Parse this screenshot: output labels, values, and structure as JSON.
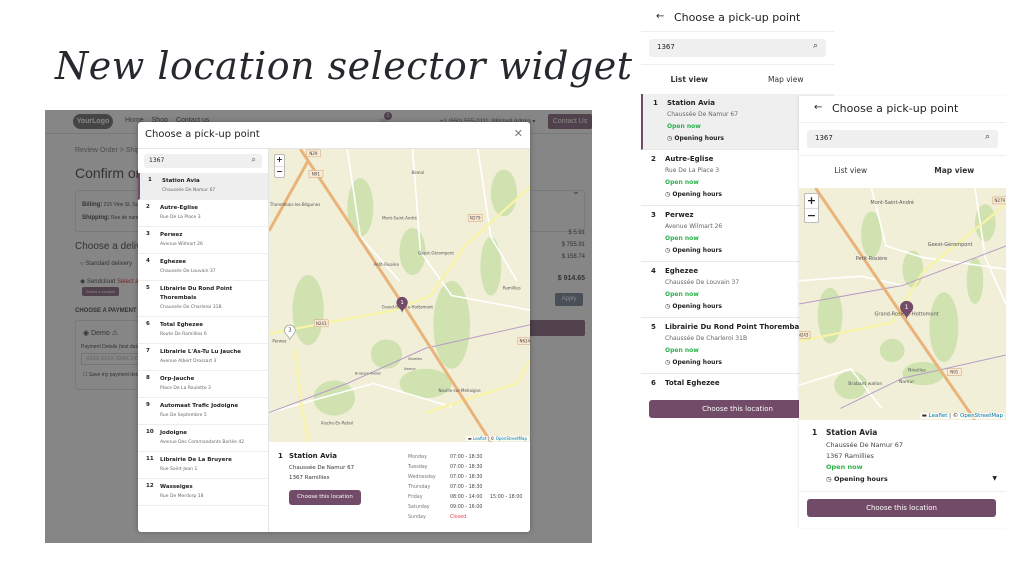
{
  "slide_title": "New location selector widget",
  "colors": {
    "brand": "#714B67",
    "open": "#2eb24a",
    "closed": "#e0454f"
  },
  "checkout": {
    "logo": "YourLogo",
    "nav": [
      "Home",
      "Shop",
      "Contact us"
    ],
    "cart_count": "1",
    "phone": "+1 (650) 555-0111",
    "user": "Mitchell Admin",
    "contact_button": "Contact Us",
    "breadcrumb": "Review Order  >  Shipping",
    "page_title": "Confirm order",
    "billing_label": "Billing:",
    "billing_value": "215 Vine St, Scranton",
    "shipping_label": "Shipping:",
    "shipping_value": "Rue de namur",
    "delivery_title": "Choose a delivery method",
    "delivery_options": [
      "Standard delivery",
      "Sendcloud"
    ],
    "sendcloud_warning": "Select a pick-up point",
    "select_location_btn": "Select a location",
    "payment_title": "CHOOSE A PAYMENT METHOD",
    "payment_option": "Demo",
    "payment_details_label": "Payment Details (test data)",
    "card_placeholder": "XXXX XXXX XXXX XXXX",
    "save_payment": "Save my payment details",
    "prices": [
      "$ 5.91",
      "$ 755.91",
      "$ 158.74"
    ],
    "total": "$ 914.65",
    "apply_button": "Apply"
  },
  "modal": {
    "title": "Choose a pick-up point",
    "search_value": "1367",
    "locations": [
      {
        "num": "1",
        "name": "Station Avia",
        "address": "Chaussée De Namur 67"
      },
      {
        "num": "2",
        "name": "Autre-Eglise",
        "address": "Rue De La Place 3"
      },
      {
        "num": "3",
        "name": "Perwez",
        "address": "Avenue Wilmart 26"
      },
      {
        "num": "4",
        "name": "Eghezee",
        "address": "Chaussée De Louvain 37"
      },
      {
        "num": "5",
        "name": "Librairie Du Rond Point Thorembais",
        "address": "Chaussée De Charleroi 31B"
      },
      {
        "num": "6",
        "name": "Total Eghezee",
        "address": "Route De Ramillies 6"
      },
      {
        "num": "7",
        "name": "Librairie L'As-Tu Lu Jauche",
        "address": "Avenue Albert Drossart 3"
      },
      {
        "num": "8",
        "name": "Orp-Jauche",
        "address": "Place De La Roulette 3"
      },
      {
        "num": "9",
        "name": "Automaat Trafic Jodoigne",
        "address": "Rue De Septembre 5"
      },
      {
        "num": "10",
        "name": "Jodoigne",
        "address": "Avenue Des Commandants Borlée 42"
      },
      {
        "num": "11",
        "name": "Librairie De La Bruyere",
        "address": "Rue Saint-Jean 1"
      },
      {
        "num": "12",
        "name": "Wasseiges",
        "address": "Rue De Merdorp 18"
      }
    ],
    "selected": {
      "num": "1",
      "name": "Station Avia",
      "street": "Chaussée De Namur 67",
      "city": "1367 Ramillies",
      "button": "Choose this location"
    },
    "hours": [
      {
        "day": "Monday",
        "t1": "07:00 - 18:30",
        "t2": ""
      },
      {
        "day": "Tuesday",
        "t1": "07:00 - 18:30",
        "t2": ""
      },
      {
        "day": "Wednesday",
        "t1": "07:00 - 18:30",
        "t2": ""
      },
      {
        "day": "Thursday",
        "t1": "07:00 - 18:30",
        "t2": ""
      },
      {
        "day": "Friday",
        "t1": "08:00 - 14:00",
        "t2": "15:00 - 18:00"
      },
      {
        "day": "Saturday",
        "t1": "09:00 - 16:00",
        "t2": ""
      },
      {
        "day": "Sunday",
        "t1": "Closed",
        "t2": ""
      }
    ],
    "map": {
      "zoom_in": "+",
      "zoom_out": "−",
      "attribution_leaflet": "Leaflet",
      "attribution_sep": " | © ",
      "attribution_osm": "OpenStreetMap",
      "places": [
        "Bomal",
        "Thorembais-les-Béguines",
        "Mont-Saint-André",
        "Geest-Gérompont",
        "Petit-Rosière",
        "Grand-Rosière-Hottomont",
        "Ramillies",
        "Perwez",
        "Noville-sur-Mehaigne",
        "Aische-En-Refail",
        "Nivelles",
        "Namur",
        "Brabant wallon"
      ],
      "roads": [
        "N29",
        "N91",
        "N279",
        "N243",
        "N624"
      ],
      "markers": [
        "1",
        "3"
      ]
    }
  },
  "mobile_list": {
    "title": "Choose a pick-up point",
    "search_value": "1367",
    "tabs": [
      "List view",
      "Map view"
    ],
    "open_now": "Open now",
    "opening_hours": "Opening hours",
    "locations": [
      {
        "num": "1",
        "name": "Station Avia",
        "address": "Chaussée De Namur 67"
      },
      {
        "num": "2",
        "name": "Autre-Eglise",
        "address": "Rue De La Place 3"
      },
      {
        "num": "3",
        "name": "Perwez",
        "address": "Avenue Wilmart 26"
      },
      {
        "num": "4",
        "name": "Eghezee",
        "address": "Chaussée De Louvain 37"
      },
      {
        "num": "5",
        "name": "Librairie Du Rond Point Thorembais",
        "address": "Chaussée De Charleroi 31B"
      },
      {
        "num": "6",
        "name": "Total Eghezee",
        "address": ""
      }
    ],
    "button": "Choose this location"
  },
  "mobile_map": {
    "title": "Choose a pick-up point",
    "search_value": "1367",
    "tabs": [
      "List view",
      "Map view"
    ],
    "places": [
      "Mont-Saint-André",
      "Geest-Gérompont",
      "Petit-Rosière",
      "Grand-Rosière-Hottomont",
      "Nivelles",
      "Namur",
      "Brabant wallon"
    ],
    "roads": [
      "N279",
      "N243",
      "N91"
    ],
    "marker": "1",
    "zoom_in": "+",
    "zoom_out": "−",
    "attribution_leaflet": "Leaflet",
    "attribution_sep": " | © ",
    "attribution_osm": "OpenStreetMap",
    "selected": {
      "num": "1",
      "name": "Station Avia",
      "street": "Chaussée De Namur 67",
      "city": "1367 Ramillies",
      "open_now": "Open now",
      "opening_hours": "Opening hours"
    },
    "button": "Choose this location"
  }
}
